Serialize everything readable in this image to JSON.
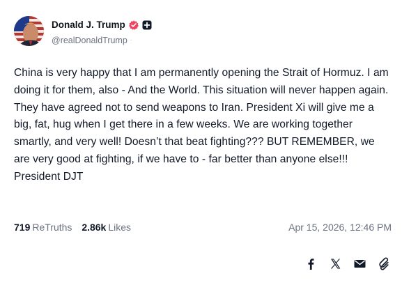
{
  "post": {
    "author": {
      "display_name": "Donald J. Trump",
      "handle": "@realDonaldTrump",
      "handle_suffix": "·",
      "verified": true,
      "avatar_icon": "avatar-flag-portrait"
    },
    "text": "China is very happy that I am permanently opening the Strait of Hormuz. I am doing it for them, also - And the World. This situation will never happen again. They have agreed not to send weapons to Iran. President Xi will give me a big, fat, hug when I get there in a few weeks. We are working together smartly, and very well! Doesn’t that beat fighting??? BUT REMEMBER, we are very good at fighting, if we have to - far better than anyone else!!! President DJT",
    "stats": {
      "retruths_count": "719",
      "retruths_label": "ReTruths",
      "likes_count": "2.86k",
      "likes_label": "Likes"
    },
    "timestamp": "Apr 15, 2026, 12:46 PM",
    "share_icons": [
      "facebook-icon",
      "x-icon",
      "email-icon",
      "link-icon"
    ]
  },
  "colors": {
    "verified_badge": "#ec4462",
    "text_primary": "#111827",
    "text_secondary": "#6b7280"
  }
}
